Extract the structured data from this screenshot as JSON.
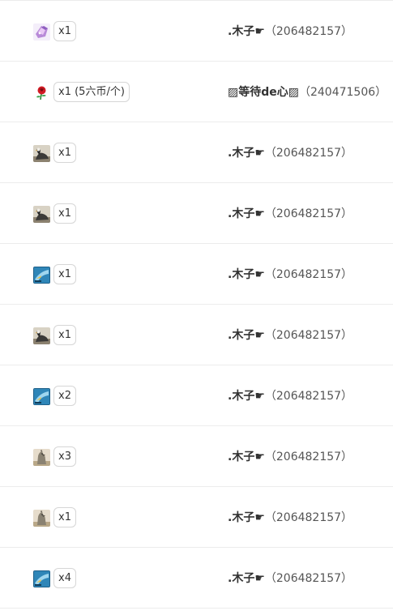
{
  "rows": [
    {
      "icon": "crystal-gift-icon",
      "qty": "x1",
      "name": ".木子☛",
      "uid": "（206482157）"
    },
    {
      "icon": "rose-gift-icon",
      "qty": "x1 (5六币/个)",
      "name": "▨等待de心▨",
      "uid": "（240471506）"
    },
    {
      "icon": "eagle-gift-icon",
      "qty": "x1",
      "name": ".木子☛",
      "uid": "（206482157）"
    },
    {
      "icon": "eagle-gift-icon",
      "qty": "x1",
      "name": ".木子☛",
      "uid": "（206482157）"
    },
    {
      "icon": "blue-card-gift-icon",
      "qty": "x1",
      "name": ".木子☛",
      "uid": "（206482157）"
    },
    {
      "icon": "eagle-gift-icon",
      "qty": "x1",
      "name": ".木子☛",
      "uid": "（206482157）"
    },
    {
      "icon": "blue-card-gift-icon",
      "qty": "x2",
      "name": ".木子☛",
      "uid": "（206482157）"
    },
    {
      "icon": "wolf-gift-icon",
      "qty": "x3",
      "name": ".木子☛",
      "uid": "（206482157）"
    },
    {
      "icon": "wolf-gift-icon",
      "qty": "x1",
      "name": ".木子☛",
      "uid": "（206482157）"
    },
    {
      "icon": "blue-card-gift-icon",
      "qty": "x4",
      "name": ".木子☛",
      "uid": "（206482157）"
    }
  ]
}
